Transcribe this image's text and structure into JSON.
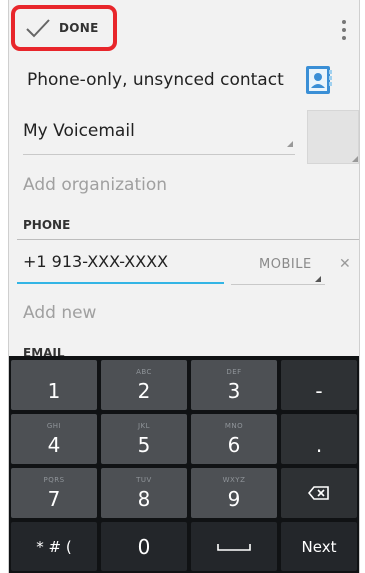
{
  "action_bar": {
    "done_label": "DONE"
  },
  "account": {
    "type_label": "Phone-only, unsynced contact"
  },
  "name": {
    "value": "My Voicemail"
  },
  "organization": {
    "placeholder": "Add organization"
  },
  "phone": {
    "header": "PHONE",
    "value": "+1 913-XXX-XXXX",
    "type_label": "MOBILE",
    "add_new_placeholder": "Add new"
  },
  "email": {
    "header": "EMAIL"
  },
  "keyboard": {
    "rows": [
      [
        {
          "digit": "1",
          "sub": ""
        },
        {
          "digit": "2",
          "sub": "ABC"
        },
        {
          "digit": "3",
          "sub": "DEF"
        },
        {
          "digit": "-",
          "sub": ""
        }
      ],
      [
        {
          "digit": "4",
          "sub": "GHI"
        },
        {
          "digit": "5",
          "sub": "JKL"
        },
        {
          "digit": "6",
          "sub": "MNO"
        },
        {
          "digit": ".",
          "sub": ""
        }
      ],
      [
        {
          "digit": "7",
          "sub": "PQRS"
        },
        {
          "digit": "8",
          "sub": "TUV"
        },
        {
          "digit": "9",
          "sub": "WXYZ"
        }
      ]
    ],
    "symbols_label": "* # (",
    "zero": "0",
    "next_label": "Next"
  },
  "colors": {
    "highlight": "#e8262b",
    "accent": "#33b5e5"
  },
  "icons": [
    "check-icon",
    "overflow-menu-icon",
    "contact-account-icon",
    "backspace-icon",
    "space-bar-icon",
    "clear-icon"
  ]
}
